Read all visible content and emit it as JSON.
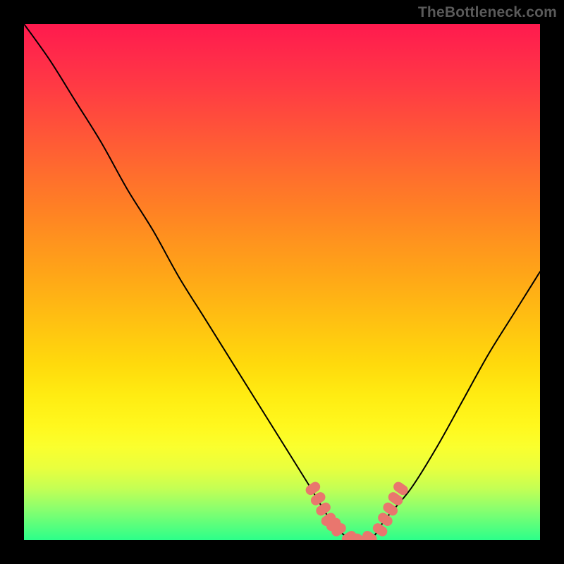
{
  "watermark": "TheBottleneck.com",
  "colors": {
    "background": "#000000",
    "gradient_top": "#ff1a4e",
    "gradient_bottom": "#2cff8a",
    "line": "#000000",
    "marker": "#e9766e"
  },
  "chart_data": {
    "type": "line",
    "title": "",
    "xlabel": "",
    "ylabel": "",
    "xlim": [
      0,
      100
    ],
    "ylim": [
      0,
      100
    ],
    "series": [
      {
        "name": "bottleneck-curve",
        "x": [
          0,
          5,
          10,
          15,
          20,
          25,
          30,
          35,
          40,
          45,
          50,
          55,
          58,
          60,
          62,
          64,
          66,
          68,
          70,
          75,
          80,
          85,
          90,
          95,
          100
        ],
        "y": [
          100,
          93,
          85,
          77,
          68,
          60,
          51,
          43,
          35,
          27,
          19,
          11,
          6,
          3,
          1,
          0,
          0,
          1,
          4,
          10,
          18,
          27,
          36,
          44,
          52
        ]
      }
    ],
    "markers": {
      "name": "highlighted-points",
      "x": [
        56,
        57,
        58,
        59,
        60,
        61,
        63,
        65,
        67,
        69,
        70,
        71,
        72,
        73
      ],
      "y": [
        10,
        8,
        6,
        4,
        3,
        2,
        0.5,
        0,
        0.5,
        2,
        4,
        6,
        8,
        10
      ]
    }
  }
}
